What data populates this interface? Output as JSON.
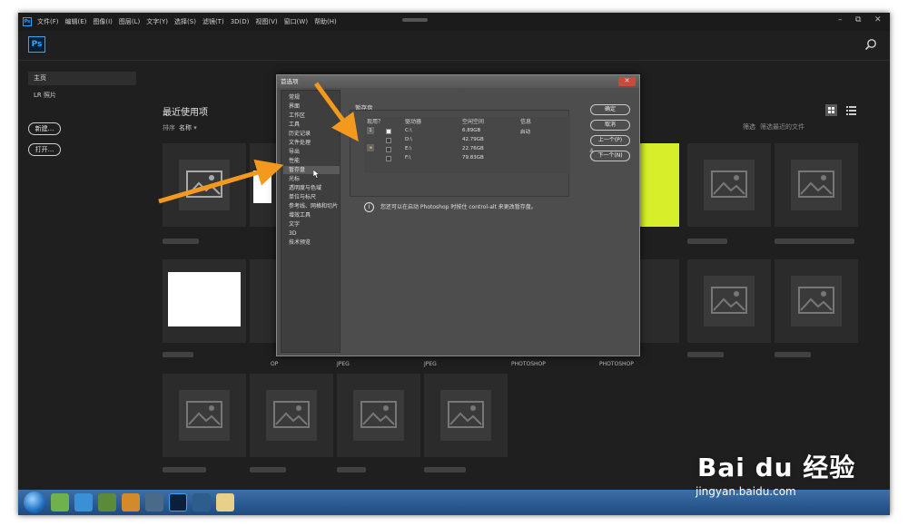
{
  "menubar": {
    "app_icon": "Ps",
    "items": [
      "文件(F)",
      "编辑(E)",
      "图像(I)",
      "图层(L)",
      "文字(Y)",
      "选择(S)",
      "滤镜(T)",
      "3D(D)",
      "视图(V)",
      "窗口(W)",
      "帮助(H)"
    ],
    "window_controls": [
      "–",
      "⧉",
      "✕"
    ]
  },
  "header": {
    "logo": "Ps",
    "search_icon": "search-icon"
  },
  "sidebar": {
    "items": [
      {
        "label": "主页",
        "active": true
      },
      {
        "label": "LR 照片",
        "active": false
      }
    ],
    "new_button": "新建...",
    "open_button": "打开..."
  },
  "recent": {
    "title": "最近使用项",
    "sort_label": "排序",
    "sort_value": "名称",
    "filter_label": "筛选",
    "filter_placeholder": "筛选最近的文件",
    "file_types": [
      "OP",
      "JPEG",
      "JPEG",
      "PHOTOSHOP",
      "PHOTOSHOP"
    ]
  },
  "preferences_dialog": {
    "title": "首选项",
    "nav_items": [
      "常规",
      "界面",
      "工作区",
      "工具",
      "历史记录",
      "文件处理",
      "导出",
      "性能",
      "暂存盘",
      "光标",
      "透明度与色域",
      "单位与标尺",
      "参考线、网格和切片",
      "增效工具",
      "文字",
      "3D",
      "技术预览"
    ],
    "selected_nav": "暂存盘",
    "section_title": "暂存盘",
    "table_headers": [
      "现用？",
      "驱动器",
      "空闲空间",
      "信息"
    ],
    "rows": [
      {
        "num": "1",
        "active": true,
        "drive": "C:\\",
        "free": "6.89GB",
        "info": "启动"
      },
      {
        "num": "",
        "active": false,
        "drive": "D:\\",
        "free": "42.79GB",
        "info": ""
      },
      {
        "num": "",
        "active": false,
        "drive": "E:\\",
        "free": "22.76GB",
        "info": ""
      },
      {
        "num": "",
        "active": false,
        "drive": "F:\\",
        "free": "79.83GB",
        "info": ""
      }
    ],
    "info_text": "您还可以在启动 Photoshop 时按住 control-alt 来更改暂存盘。",
    "buttons": {
      "ok": "确定",
      "cancel": "取消",
      "prev": "上一个(P)",
      "next": "下一个(N)"
    }
  },
  "watermark": {
    "logo": "Bai du 经验",
    "url": "jingyan.baidu.com"
  },
  "colors": {
    "accent": "#31a8ff",
    "arrow": "#f39a1e",
    "dialog_bg": "#4d4d4d",
    "app_bg": "#1f1f1f"
  }
}
